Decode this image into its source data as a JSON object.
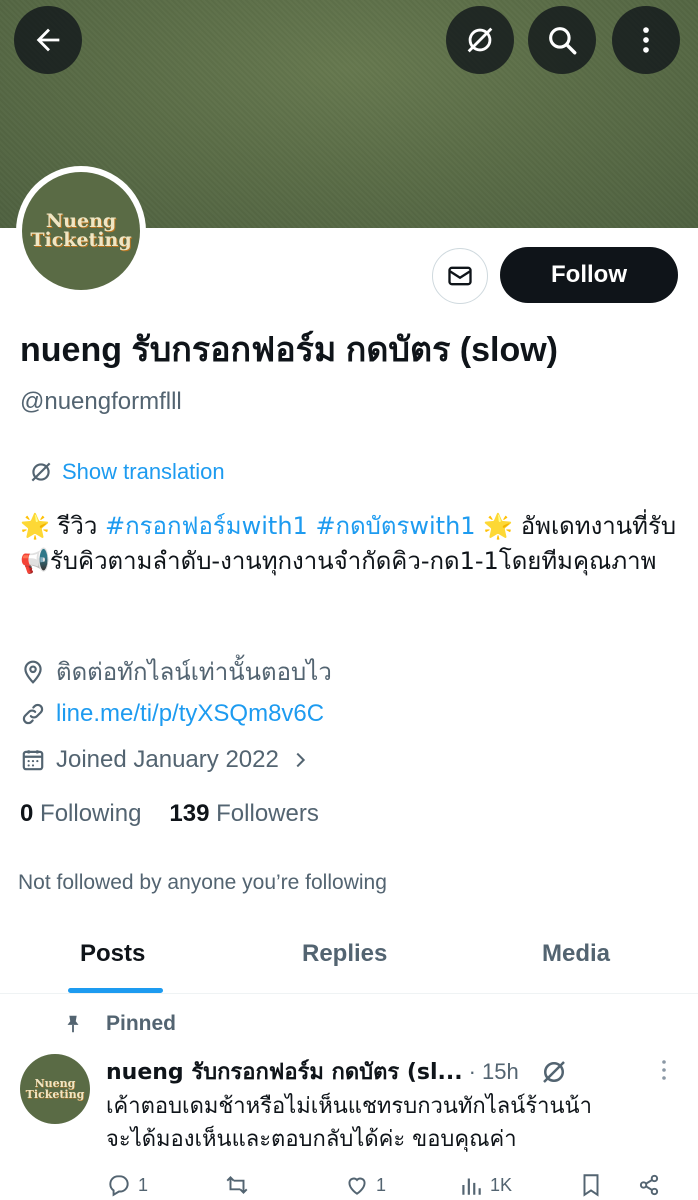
{
  "profile": {
    "name": "nueng รับกรอกฟอร์ม กดบัตร (slow)",
    "handle": "@nuengformflll",
    "avatar_text_line1": "Nueng",
    "avatar_text_line2": "Ticketing",
    "show_translation": "Show translation",
    "bio_star": "🌟",
    "bio_part1": "รีวิว",
    "bio_tag1": "#กรอกฟอร์มwith1",
    "bio_tag2": "#กดบัตรwith1",
    "bio_part2": "อัพเดทงานที่รับ",
    "bio_megaphone": "📢",
    "bio_part3": "รับคิวตามลำดับ-งานทุกงานจำกัดคิว-กด1-1โดยทีมคุณภาพ",
    "location": "ติดต่อทักไลน์เท่านั้นตอบไว",
    "link": "line.me/ti/p/tyXSQm8v6C",
    "joined": "Joined January 2022",
    "following_count": "0",
    "following_label": "Following",
    "followers_count": "139",
    "followers_label": "Followers",
    "not_followed": "Not followed by anyone you’re following"
  },
  "actions": {
    "follow_label": "Follow"
  },
  "tabs": [
    {
      "label": "Posts",
      "active": true
    },
    {
      "label": "Replies",
      "active": false
    },
    {
      "label": "Media",
      "active": false
    }
  ],
  "post": {
    "pinned_label": "Pinned",
    "author": "nueng รับกรอกฟอร์ม กดบัตร (sl...",
    "separator": "·",
    "time": "15h",
    "line1": "เค้าตอบเดมช้าหรือไม่เห็นแชทรบกวนทักไลน์ร้านน้า",
    "line2": "จะได้มองเห็นและตอบกลับได้ค่ะ ขอบคุณค่า",
    "replies": "1",
    "likes": "1",
    "views": "1K"
  },
  "colors": {
    "accent": "#1d9bf0",
    "banner": "#5b6d47",
    "text": "#0f1419",
    "muted": "#536471"
  }
}
